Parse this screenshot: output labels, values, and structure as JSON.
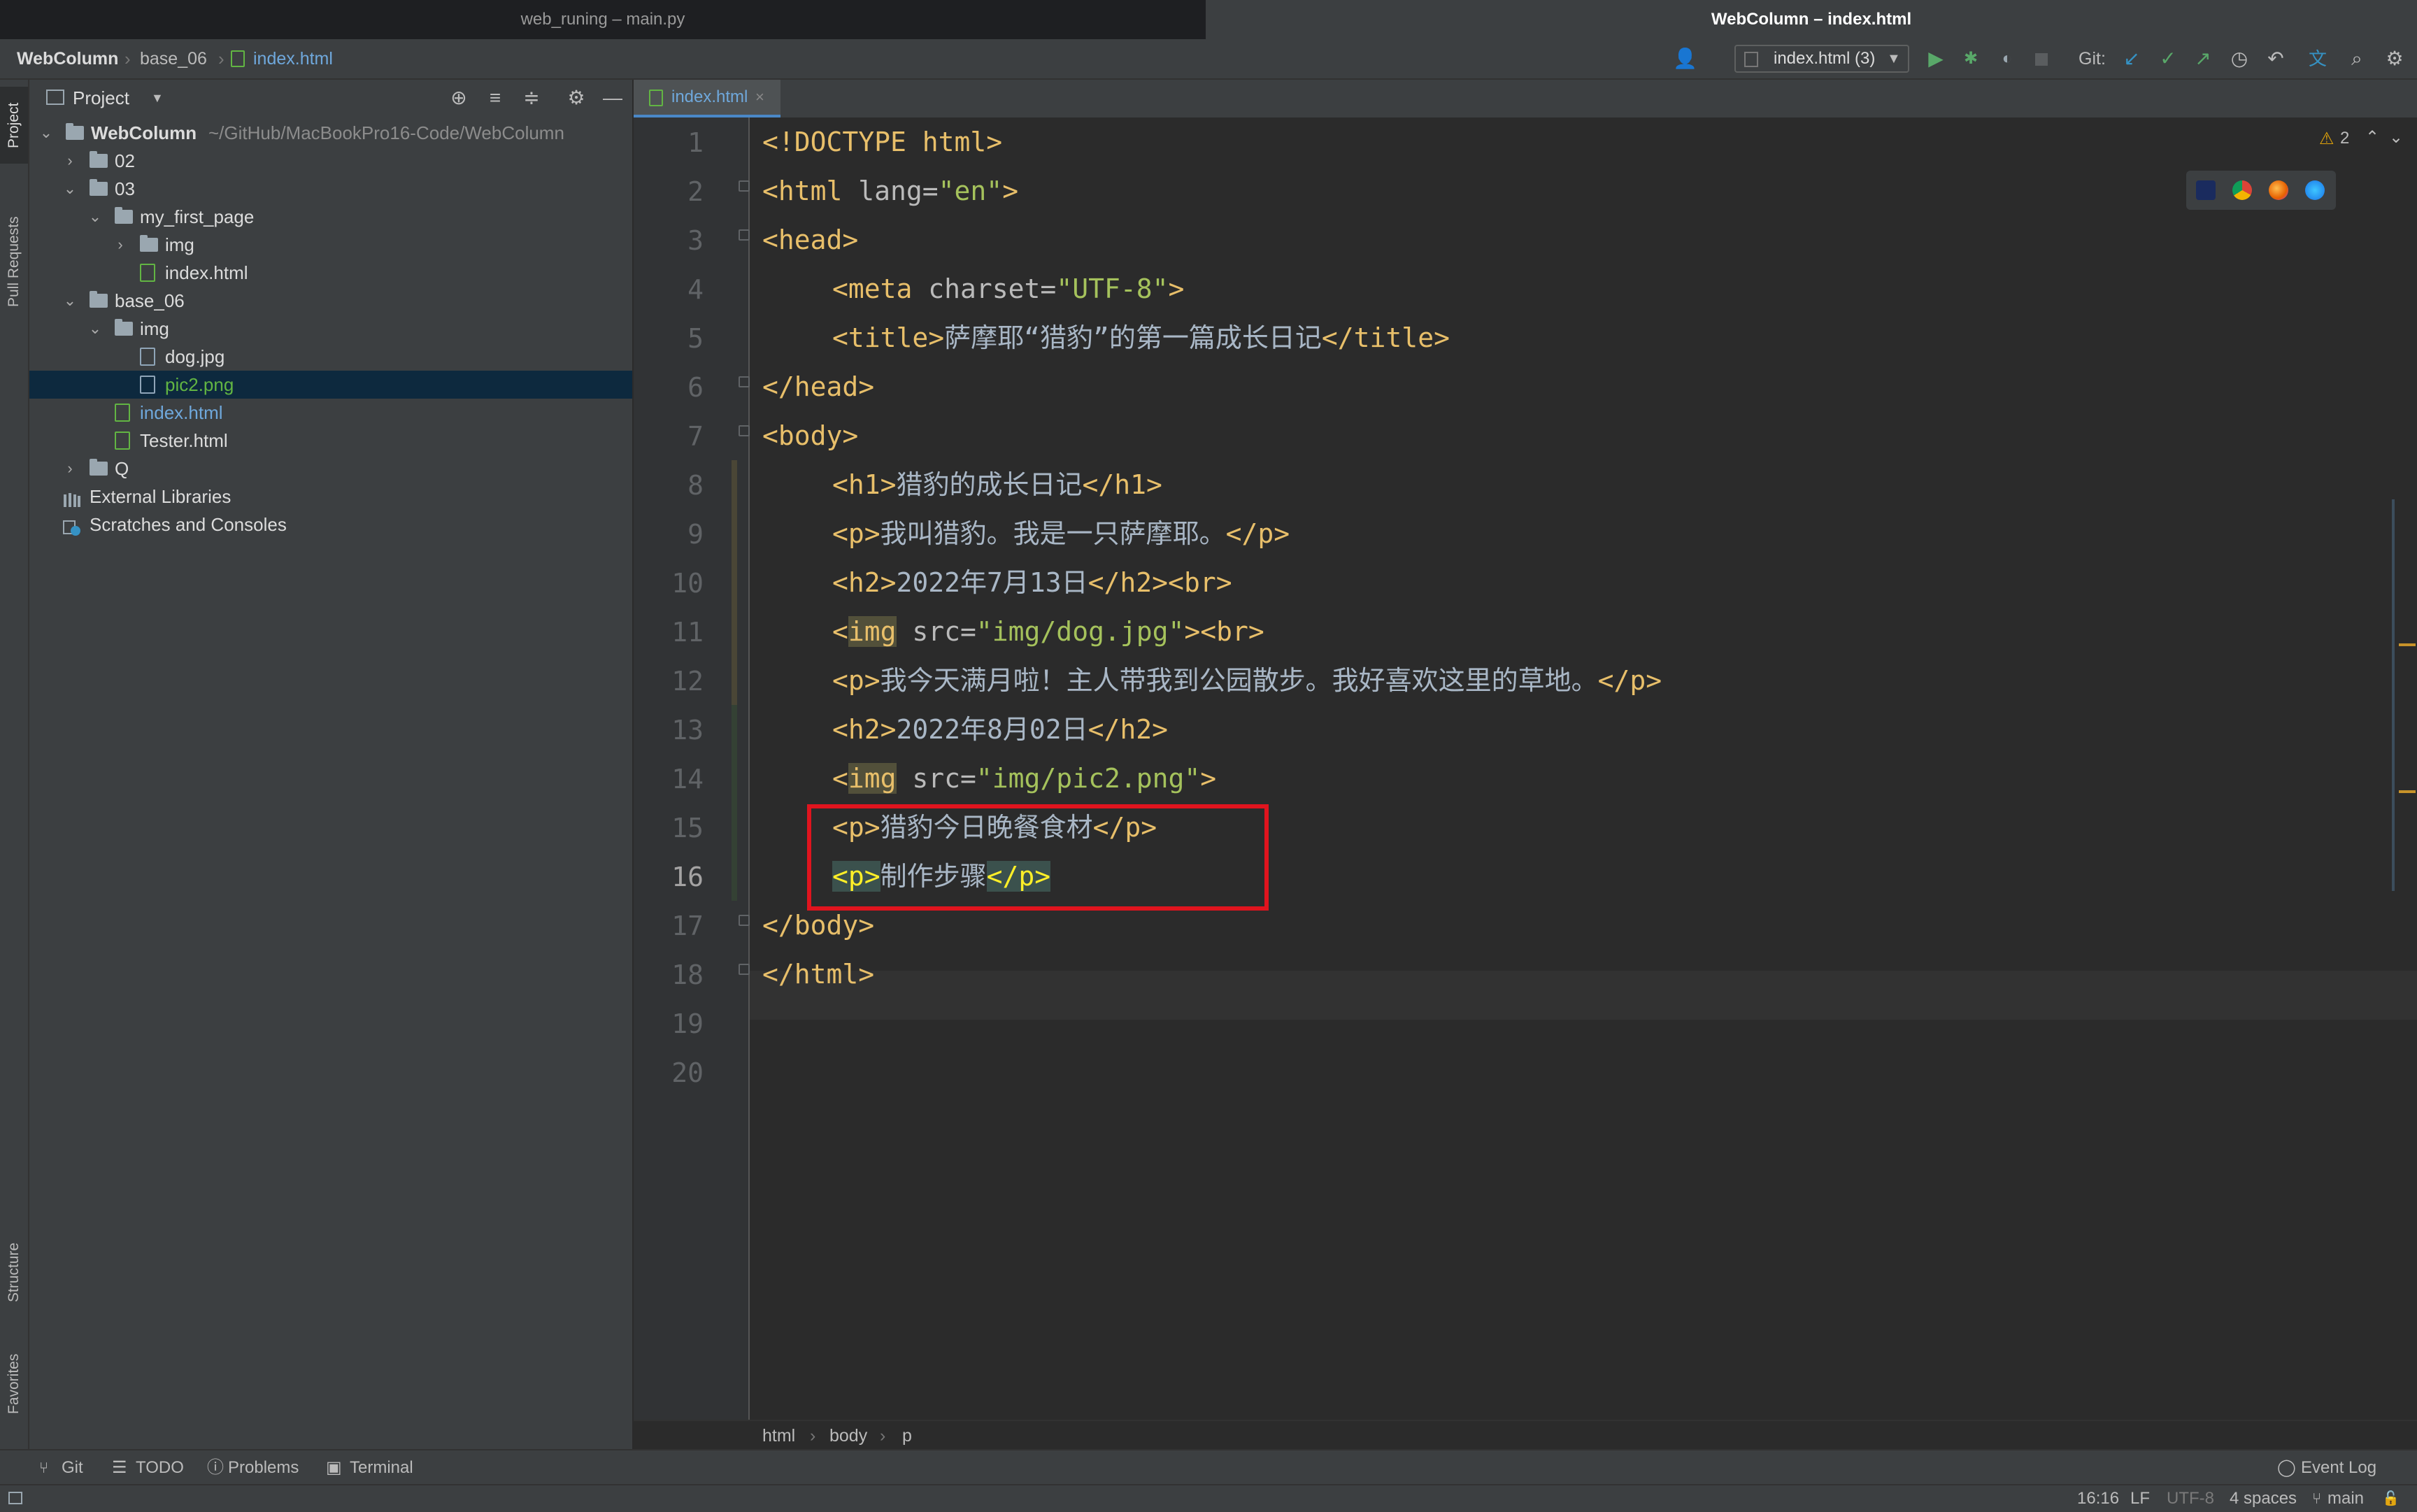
{
  "window_tabs": {
    "left": "web_runing – main.py",
    "right": "WebColumn – index.html"
  },
  "breadcrumb": {
    "project": "WebColumn",
    "folder": "base_06",
    "file": "index.html"
  },
  "run_config": {
    "label": "index.html (3)"
  },
  "git": {
    "label": "Git:"
  },
  "left_stripe": {
    "project": "Project",
    "pull_requests": "Pull Requests",
    "structure": "Structure",
    "favorites": "Favorites"
  },
  "project_panel": {
    "title": "Project",
    "root": {
      "name": "WebColumn",
      "path": "~/GitHub/MacBookPro16-Code/WebColumn"
    },
    "items": [
      {
        "name": "02",
        "type": "folder",
        "depth": 1,
        "expanded": false
      },
      {
        "name": "03",
        "type": "folder",
        "depth": 1,
        "expanded": true
      },
      {
        "name": "my_first_page",
        "type": "folder",
        "depth": 2,
        "expanded": true
      },
      {
        "name": "img",
        "type": "folder",
        "depth": 3,
        "expanded": false
      },
      {
        "name": "index.html",
        "type": "html",
        "depth": 4
      },
      {
        "name": "base_06",
        "type": "folder",
        "depth": 1,
        "expanded": true
      },
      {
        "name": "img",
        "type": "folder",
        "depth": 2,
        "expanded": true
      },
      {
        "name": "dog.jpg",
        "type": "image",
        "depth": 4
      },
      {
        "name": "pic2.png",
        "type": "image",
        "depth": 4,
        "selected": true
      },
      {
        "name": "index.html",
        "type": "html",
        "depth": 3
      },
      {
        "name": "Tester.html",
        "type": "html",
        "depth": 3
      },
      {
        "name": "Q",
        "type": "folder",
        "depth": 1,
        "expanded": false
      }
    ],
    "external_libraries": "External Libraries",
    "scratches": "Scratches and Consoles"
  },
  "editor": {
    "tab_label": "index.html",
    "warnings": "2",
    "lines": [
      "1",
      "2",
      "3",
      "4",
      "5",
      "6",
      "7",
      "8",
      "9",
      "10",
      "11",
      "12",
      "13",
      "14",
      "15",
      "16",
      "17",
      "18",
      "19",
      "20"
    ],
    "code": {
      "l1": "<!DOCTYPE html>",
      "l2_open": "<html ",
      "l2_attr": "lang=",
      "l2_val": "\"en\"",
      "l2_close": ">",
      "l3": "<head>",
      "l4_open": "<meta ",
      "l4_attr": "charset=",
      "l4_val": "\"UTF-8\"",
      "l4_close": ">",
      "l5_open": "<title>",
      "l5_text": "萨摩耶“猎豹”的第一篇成长日记",
      "l5_close": "</title>",
      "l6": "</head>",
      "l7": "<body>",
      "l8_open": "<h1>",
      "l8_text": "猎豹的成长日记",
      "l8_close": "</h1>",
      "l9_open": "<p>",
      "l9_text": "我叫猎豹。我是一只萨摩耶。",
      "l9_close": "</p>",
      "l10_open": "<h2>",
      "l10_text": "2022年7月13日",
      "l10_close": "</h2><br>",
      "l11_lt": "<",
      "l11_tag": "img",
      "l11_attr": " src=",
      "l11_val": "\"img/dog.jpg\"",
      "l11_close": "><br>",
      "l12_open": "<p>",
      "l12_text": "我今天满月啦！主人带我到公园散步。我好喜欢这里的草地。",
      "l12_close": "</p>",
      "l13_open": "<h2>",
      "l13_text": "2022年8月02日",
      "l13_close": "</h2>",
      "l14_lt": "<",
      "l14_tag": "img",
      "l14_attr": " src=",
      "l14_val": "\"img/pic2.png\"",
      "l14_close": ">",
      "l15_open": "<p>",
      "l15_text": "猎豹今日晚餐食材",
      "l15_close": "</p>",
      "l16_open": "<p>",
      "l16_text": "制作步骤",
      "l16_close": "</p>",
      "l17": "</body>",
      "l18": "</html>"
    },
    "bottom_breadcrumb": [
      "html",
      "body",
      "p"
    ]
  },
  "tool_windows": {
    "git": "Git",
    "todo": "TODO",
    "problems": "Problems",
    "terminal": "Terminal",
    "event_log": "Event Log"
  },
  "status": {
    "position": "16:16",
    "line_sep": "LF",
    "encoding": "UTF-8",
    "indent": "4 spaces",
    "branch": "main"
  }
}
